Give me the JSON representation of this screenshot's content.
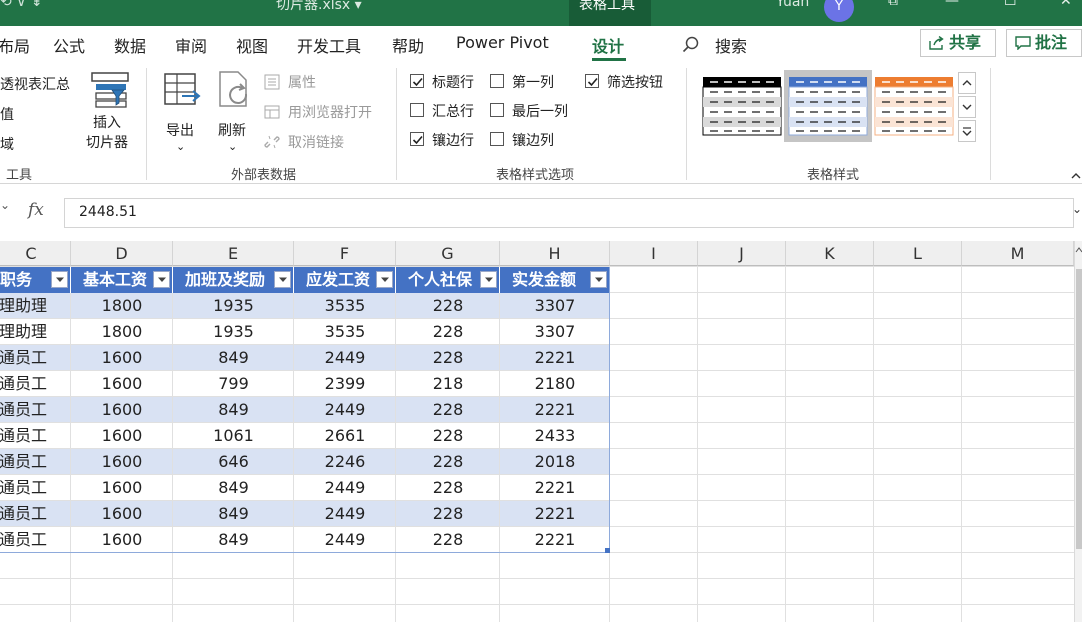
{
  "title_bar": {
    "left_partial": "⟲ ∨  ⇟",
    "file_name": "切片器.xlsx",
    "file_caret": "▾",
    "context_tab": "表格工具",
    "user_name": "Yuan",
    "avatar_letter": "Y",
    "restore_glyph": "⧉",
    "minimize_glyph": "—",
    "maximize_glyph": "☐",
    "close_glyph": "✕"
  },
  "tabs": [
    {
      "label": "布局",
      "active": false
    },
    {
      "label": "公式",
      "active": false
    },
    {
      "label": "数据",
      "active": false
    },
    {
      "label": "审阅",
      "active": false
    },
    {
      "label": "视图",
      "active": false
    },
    {
      "label": "开发工具",
      "active": false
    },
    {
      "label": "帮助",
      "active": false
    },
    {
      "label": "Power Pivot",
      "active": false
    },
    {
      "label": "设计",
      "active": true
    }
  ],
  "search": {
    "icon": "search-icon",
    "label": "搜索"
  },
  "share_button": {
    "label": "共享",
    "icon": "share-icon"
  },
  "comment_button": {
    "label": "批注",
    "icon": "comment-icon"
  },
  "ribbon": {
    "tools_group": {
      "items": [
        "透视表汇总",
        "值",
        "域"
      ],
      "label": "工具",
      "insert_slicer": "插入\n切片器"
    },
    "external_group": {
      "export_label": "导出",
      "refresh_label": "刷新",
      "properties_label": "属性",
      "open_browser_label": "用浏览器打开",
      "unlink_label": "取消链接",
      "label": "外部表数据"
    },
    "style_options_group": {
      "options": [
        {
          "label": "标题行",
          "checked": true
        },
        {
          "label": "第一列",
          "checked": false
        },
        {
          "label": "筛选按钮",
          "checked": true
        },
        {
          "label": "汇总行",
          "checked": false
        },
        {
          "label": "最后一列",
          "checked": false
        },
        {
          "label": "镶边行",
          "checked": true
        },
        {
          "label": "镶边列",
          "checked": false
        }
      ],
      "label": "表格样式选项"
    },
    "table_styles_group": {
      "label": "表格样式",
      "colors": [
        "#000000",
        "#4472c4",
        "#ed7d31"
      ]
    }
  },
  "formula_bar": {
    "fx_label": "fx",
    "value": "2448.51"
  },
  "sheet": {
    "column_headers": [
      "C",
      "D",
      "E",
      "F",
      "G",
      "H",
      "I",
      "J",
      "K",
      "L",
      "M"
    ],
    "table_headers": [
      "职务",
      "基本工资",
      "加班及奖励",
      "应发工资",
      "个人社保",
      "实发金额"
    ],
    "rows": [
      [
        "理助理",
        "1800",
        "1935",
        "3535",
        "228",
        "3307"
      ],
      [
        "理助理",
        "1800",
        "1935",
        "3535",
        "228",
        "3307"
      ],
      [
        "通员工",
        "1600",
        "849",
        "2449",
        "228",
        "2221"
      ],
      [
        "通员工",
        "1600",
        "799",
        "2399",
        "218",
        "2180"
      ],
      [
        "通员工",
        "1600",
        "849",
        "2449",
        "228",
        "2221"
      ],
      [
        "通员工",
        "1600",
        "1061",
        "2661",
        "228",
        "2433"
      ],
      [
        "通员工",
        "1600",
        "646",
        "2246",
        "228",
        "2018"
      ],
      [
        "通员工",
        "1600",
        "849",
        "2449",
        "228",
        "2221"
      ],
      [
        "通员工",
        "1600",
        "849",
        "2449",
        "228",
        "2221"
      ],
      [
        "通员工",
        "1600",
        "849",
        "2449",
        "228",
        "2221"
      ]
    ],
    "header_color": "#4472c4",
    "band_color": "#d9e2f3"
  }
}
